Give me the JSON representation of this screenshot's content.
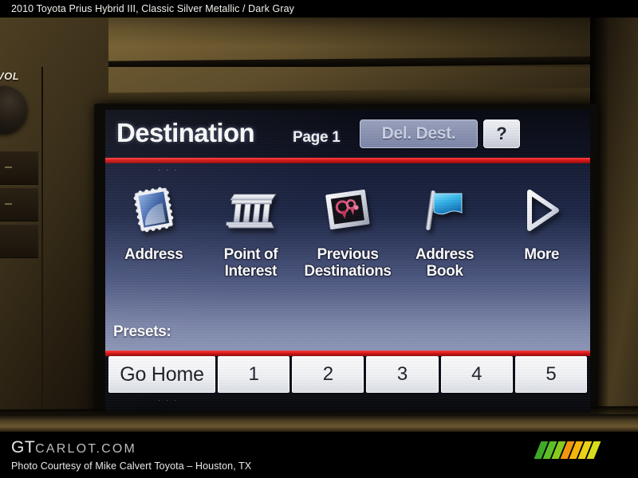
{
  "listing": {
    "caption": "2010 Toyota Prius Hybrid III,  Classic Silver Metallic / Dark Gray"
  },
  "dashboard": {
    "volume_label": "VOL"
  },
  "nav_screen": {
    "header": {
      "title": "Destination",
      "page_label": "Page 1",
      "delete_destination_label": "Del. Dest.",
      "help_label": "?"
    },
    "menu_items": [
      {
        "label": "Address",
        "icon": "stamp-icon"
      },
      {
        "label": "Point of\nInterest",
        "line1": "Point of",
        "line2": "Interest",
        "icon": "bank-building-icon"
      },
      {
        "label": "Previous\nDestinations",
        "line1": "Previous",
        "line2": "Destinations",
        "icon": "framed-pins-icon"
      },
      {
        "label": "Address\nBook",
        "line1": "Address",
        "line2": "Book",
        "icon": "blue-flag-icon"
      },
      {
        "label": "More",
        "line1": "More",
        "line2": "",
        "icon": "arrow-right-triangle-icon"
      }
    ],
    "presets": {
      "label": "Presets:",
      "buttons": [
        {
          "label": "Go Home"
        },
        {
          "label": "1"
        },
        {
          "label": "2"
        },
        {
          "label": "3"
        },
        {
          "label": "4"
        },
        {
          "label": "5"
        }
      ]
    },
    "dots_marker": "· · ·",
    "colors": {
      "accent_rule": "#e01414",
      "screen_top": "#141a33",
      "screen_bottom": "#8e97b8",
      "flag_blue": "#4fc3f0",
      "pin_pink": "#e8527f"
    }
  },
  "watermark": {
    "brand_bold": "GT",
    "brand_rest": "CARLOT.COM",
    "credit": "Photo Courtesy of Mike Calvert Toyota – Houston, TX",
    "logo_slash_colors": [
      "#3fa828",
      "#5cbf2a",
      "#86cc1f",
      "#f0960f",
      "#f5b60c",
      "#e8d318",
      "#d8dd1c"
    ]
  }
}
